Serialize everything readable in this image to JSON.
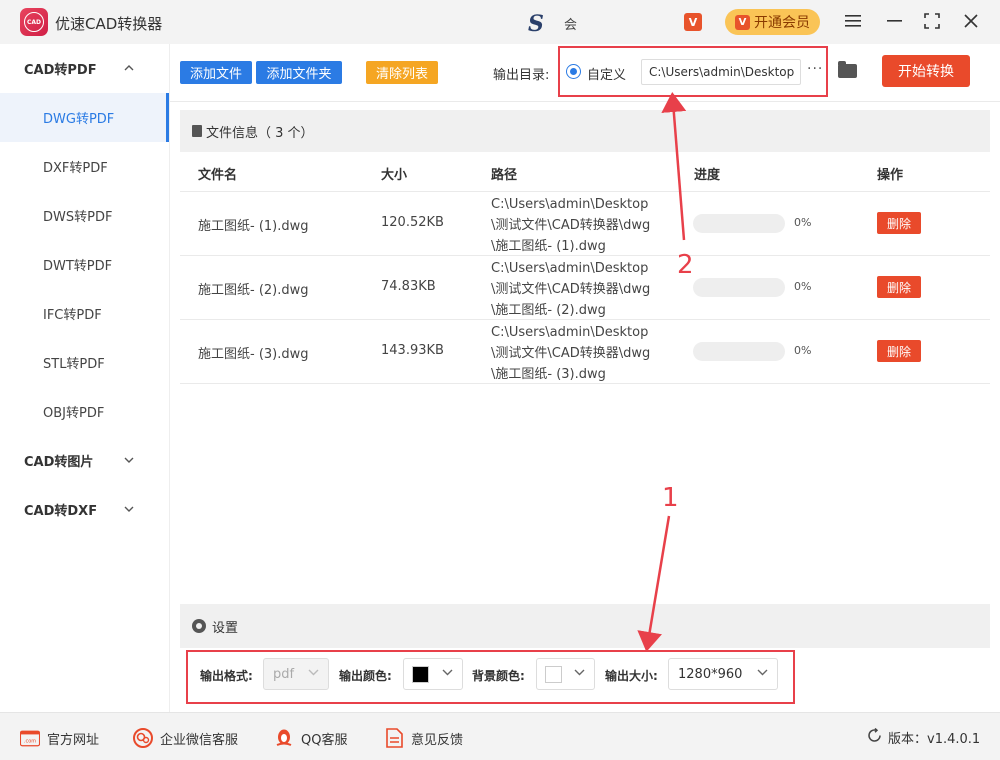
{
  "app": {
    "title": "优速CAD转换器",
    "logo_text": "CAD",
    "sponsor_text": "会"
  },
  "header": {
    "vip_label": "开通会员",
    "vip_badge": "V"
  },
  "sidebar": {
    "groups": [
      {
        "label": "CAD转PDF",
        "expanded": true,
        "items": [
          "DWG转PDF",
          "DXF转PDF",
          "DWS转PDF",
          "DWT转PDF",
          "IFC转PDF",
          "STL转PDF",
          "OBJ转PDF"
        ],
        "active": "DWG转PDF"
      },
      {
        "label": "CAD转图片",
        "expanded": false
      },
      {
        "label": "CAD转DXF",
        "expanded": false
      }
    ]
  },
  "toolbar": {
    "add_file": "添加文件",
    "add_folder": "添加文件夹",
    "clear_list": "清除列表",
    "output_dir_label": "输出目录:",
    "custom_label": "自定义",
    "output_path": "C:\\Users\\admin\\Desktop",
    "more": "···",
    "start": "开始转换"
  },
  "files": {
    "header": "文件信息（ 3 个）",
    "columns": {
      "name": "文件名",
      "size": "大小",
      "path": "路径",
      "progress": "进度",
      "action": "操作"
    },
    "rows": [
      {
        "name": "施工图纸- (1).dwg",
        "size": "120.52KB",
        "path_lines": [
          "C:\\Users\\admin\\Desktop",
          "\\测试文件\\CAD转换器\\dwg",
          "\\施工图纸- (1).dwg"
        ],
        "progress": 0,
        "progress_text": "0%",
        "delete": "删除"
      },
      {
        "name": "施工图纸- (2).dwg",
        "size": "74.83KB",
        "path_lines": [
          "C:\\Users\\admin\\Desktop",
          "\\测试文件\\CAD转换器\\dwg",
          "\\施工图纸- (2).dwg"
        ],
        "progress": 0,
        "progress_text": "0%",
        "delete": "删除"
      },
      {
        "name": "施工图纸- (3).dwg",
        "size": "143.93KB",
        "path_lines": [
          "C:\\Users\\admin\\Desktop",
          "\\测试文件\\CAD转换器\\dwg",
          "\\施工图纸- (3).dwg"
        ],
        "progress": 0,
        "progress_text": "0%",
        "delete": "删除"
      }
    ]
  },
  "settings": {
    "header": "设置",
    "format_label": "输出格式:",
    "format_value": "pdf",
    "color_label": "输出颜色:",
    "color_value": "#000000",
    "bg_label": "背景颜色:",
    "bg_value": "#ffffff",
    "size_label": "输出大小:",
    "size_value": "1280*960"
  },
  "footer": {
    "website": "官方网址",
    "wechat": "企业微信客服",
    "qq": "QQ客服",
    "feedback": "意见反馈",
    "version": "版本：v1.4.0.1",
    "website_icon_text": ".com"
  },
  "annotations": [
    "1",
    "2"
  ],
  "colors": {
    "accent": "#2b7be4",
    "danger": "#e94a2b",
    "orange": "#f5a623",
    "highlight": "#e8404a"
  }
}
